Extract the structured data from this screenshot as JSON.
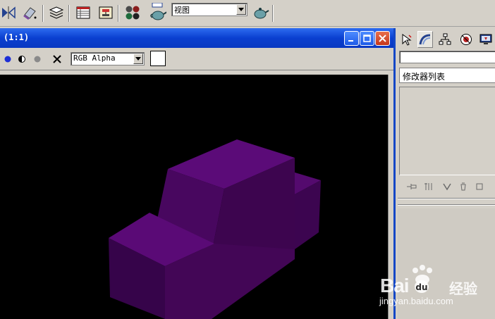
{
  "toolbar": {
    "view_combo_value": "视图"
  },
  "render_window": {
    "title": "(1:1)",
    "channel_combo_value": "RGB Alpha"
  },
  "command_panel": {
    "modifier_list_label": "修改器列表"
  },
  "watermark": {
    "brand": "Bai",
    "brand_suffix": "经验",
    "url": "jingyan.baidu.com"
  },
  "colors": {
    "viewport_background": "#000000",
    "object_top": "#5a0a76",
    "object_front": "#430656",
    "object_side": "#36044a",
    "titlebar_blue": "#0a3fd0"
  }
}
